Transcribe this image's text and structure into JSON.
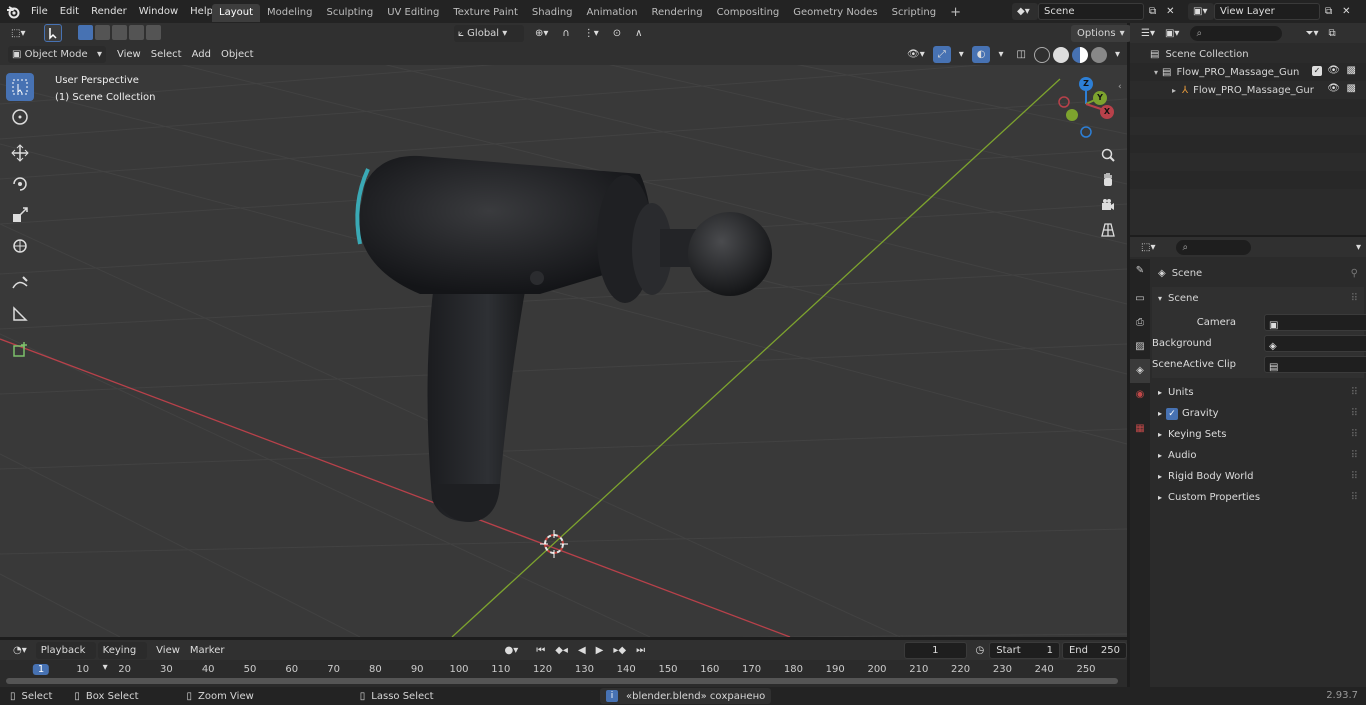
{
  "menu": {
    "items": [
      "File",
      "Edit",
      "Render",
      "Window",
      "Help"
    ]
  },
  "workspaces": {
    "tabs": [
      "Layout",
      "Modeling",
      "Sculpting",
      "UV Editing",
      "Texture Paint",
      "Shading",
      "Animation",
      "Rendering",
      "Compositing",
      "Geometry Nodes",
      "Scripting"
    ],
    "active": "Layout",
    "add": "+"
  },
  "scene_selector": {
    "value": "Scene"
  },
  "view_layer_selector": {
    "value": "View Layer"
  },
  "viewport_header": {
    "mode": "Object Mode",
    "menus": [
      "View",
      "Select",
      "Add",
      "Object"
    ],
    "orientation": "Global",
    "options": "Options"
  },
  "viewport": {
    "overlay_line1": "User Perspective",
    "overlay_line2": "(1) Scene Collection",
    "gizmo_axes": {
      "z": "Z",
      "y": "Y",
      "x": "X"
    }
  },
  "outliner": {
    "root": "Scene Collection",
    "items": [
      {
        "label": "Flow_PRO_Massage_Gun",
        "indent": 1
      },
      {
        "label": "Flow_PRO_Massage_Gur",
        "indent": 2
      }
    ]
  },
  "properties": {
    "context_label": "Scene",
    "panel_title": "Scene",
    "fields": [
      {
        "label": "Camera"
      },
      {
        "label": "Background Scene"
      },
      {
        "label": "Active Clip"
      }
    ],
    "sections": [
      "Units",
      "Gravity",
      "Keying Sets",
      "Audio",
      "Rigid Body World",
      "Custom Properties"
    ],
    "gravity_checked": true
  },
  "timeline": {
    "menus": [
      "Playback",
      "Keying",
      "View",
      "Marker"
    ],
    "current_frame": "1",
    "start_label": "Start",
    "start_value": "1",
    "end_label": "End",
    "end_value": "250",
    "ruler": [
      "1",
      "10",
      "20",
      "30",
      "40",
      "50",
      "60",
      "70",
      "80",
      "90",
      "100",
      "110",
      "120",
      "130",
      "140",
      "150",
      "160",
      "170",
      "180",
      "190",
      "200",
      "210",
      "220",
      "230",
      "240",
      "250"
    ]
  },
  "statusbar": {
    "select": "Select",
    "box_select": "Box Select",
    "zoom_view": "Zoom View",
    "lasso_select": "Lasso Select",
    "message": "«blender.blend» сохранено",
    "version": "2.93.7"
  },
  "colors": {
    "accent": "#4772b3",
    "x_axis": "#b8414a",
    "y_axis": "#7da32e",
    "z_axis": "#2d7fd6"
  }
}
